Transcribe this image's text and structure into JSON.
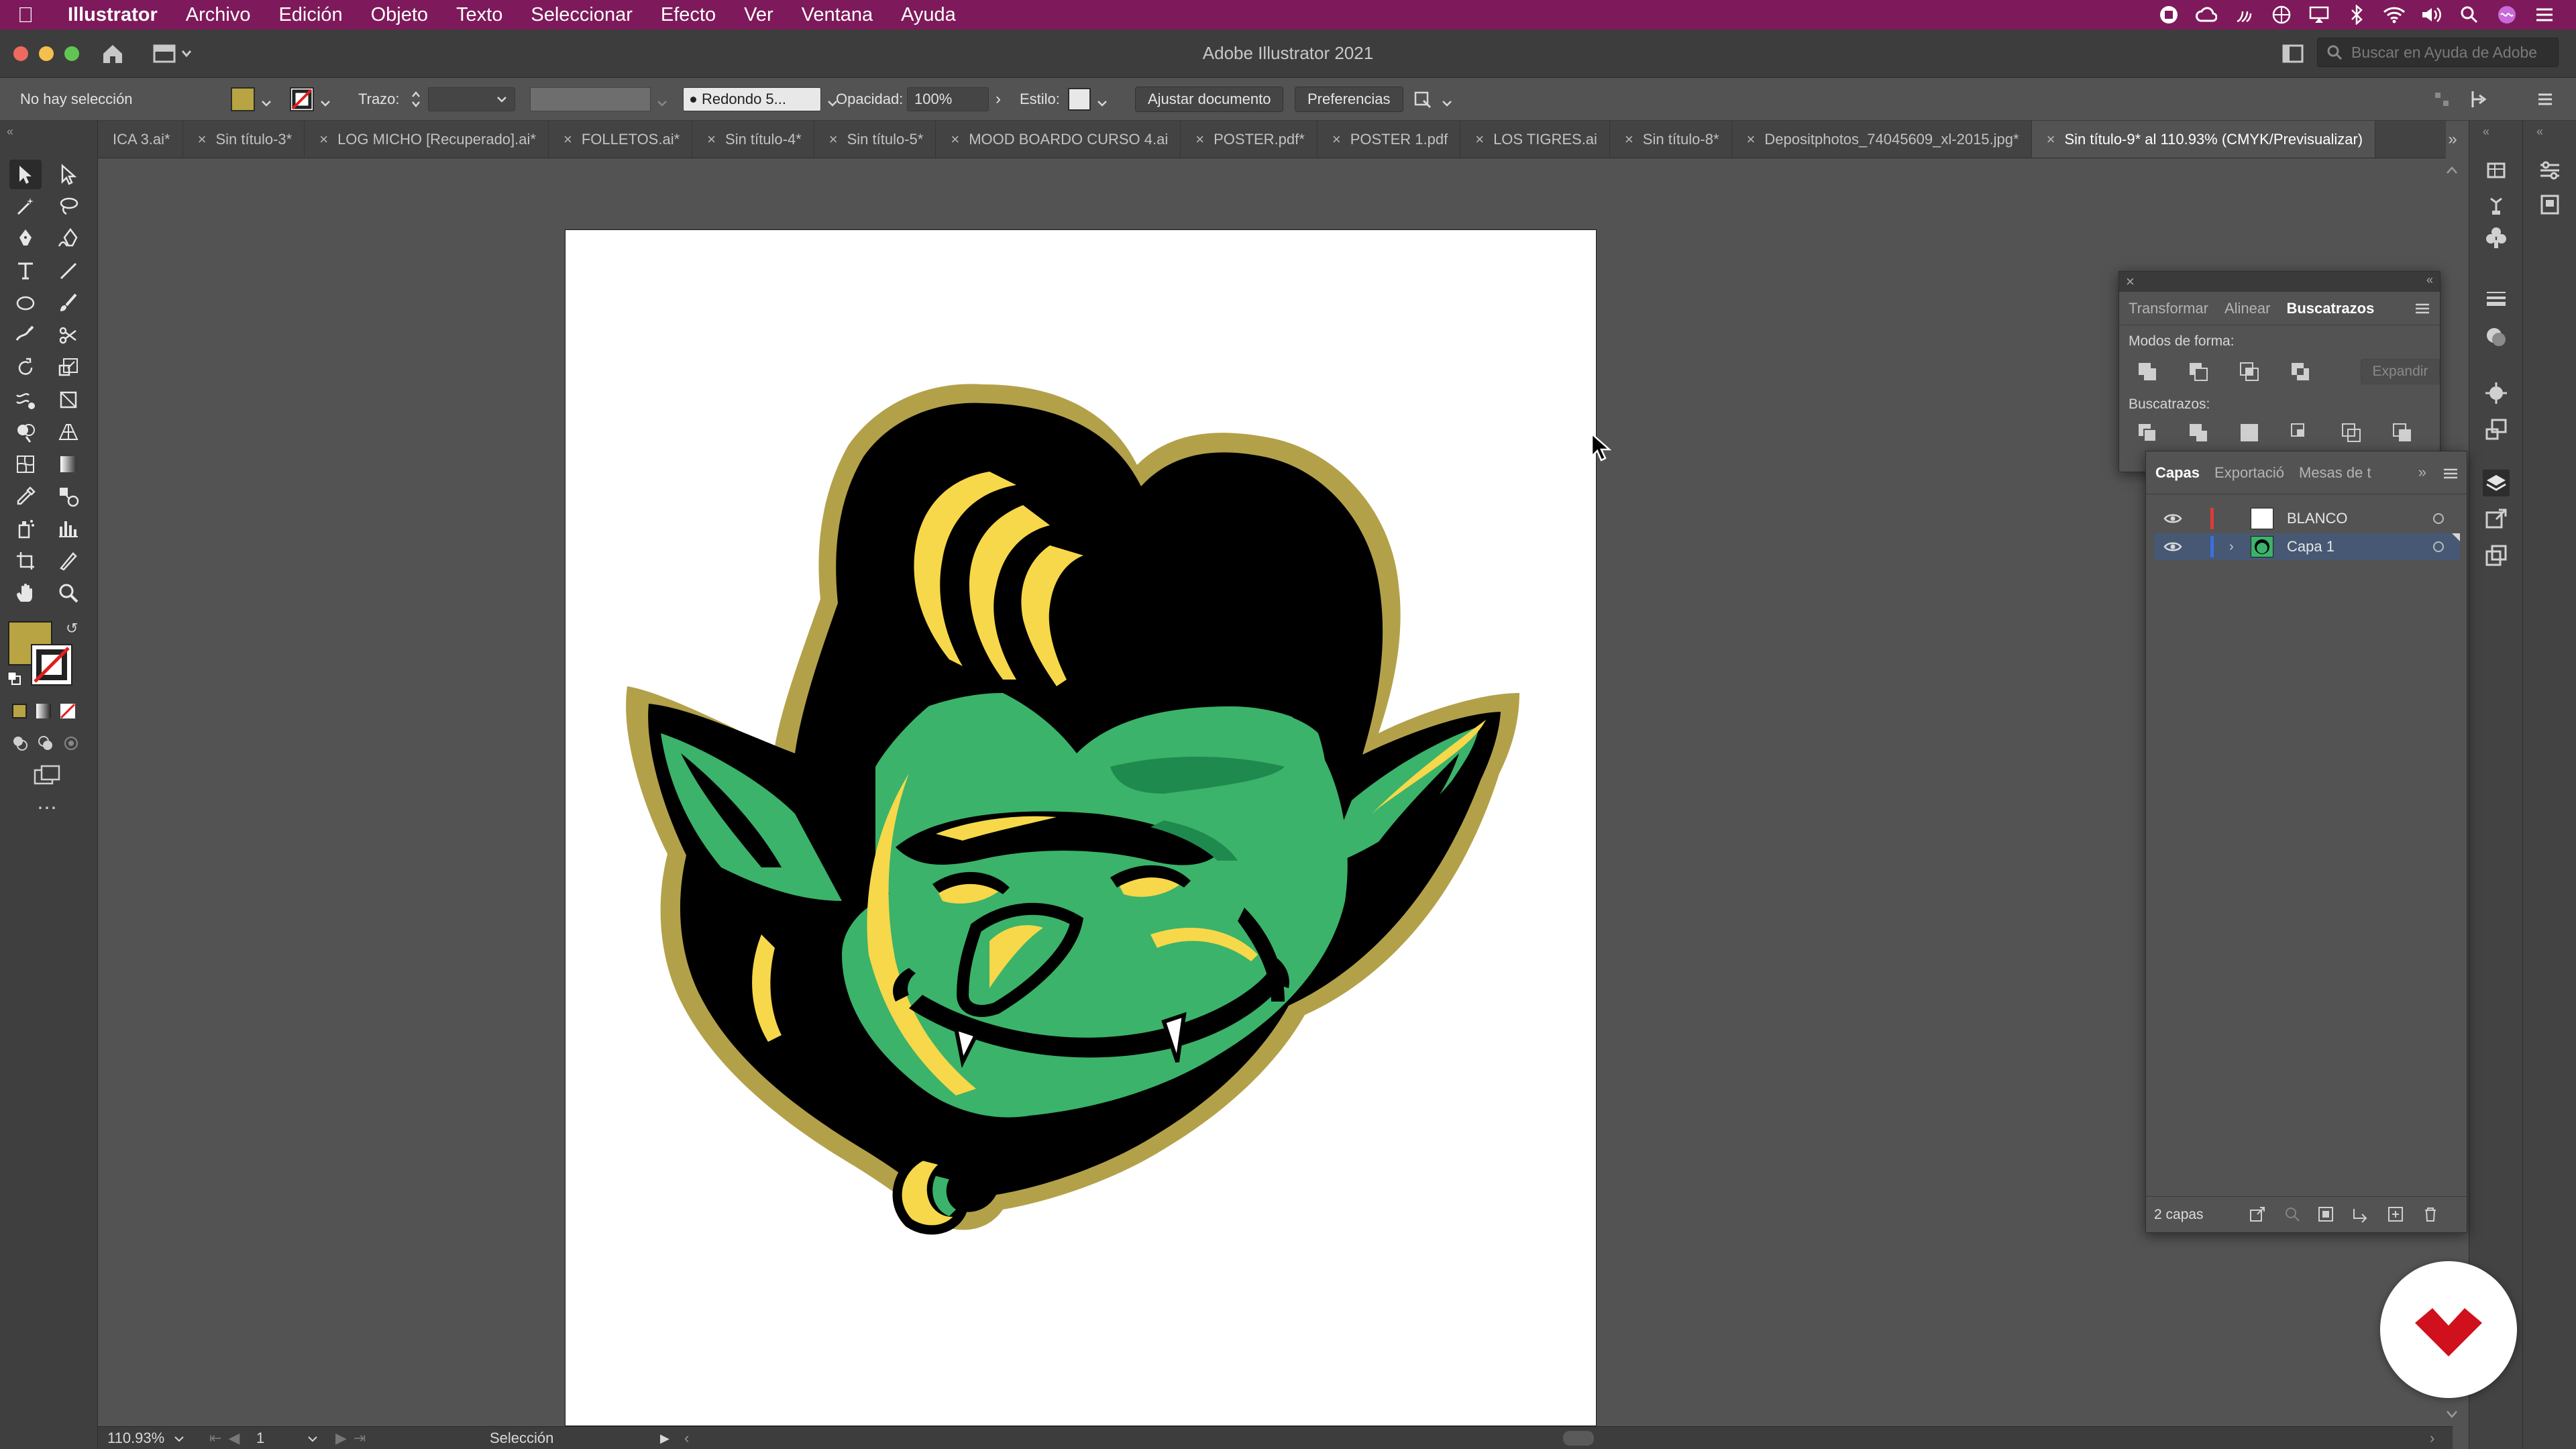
{
  "menubar": {
    "app_name": "Illustrator",
    "items": [
      "Archivo",
      "Edición",
      "Objeto",
      "Texto",
      "Seleccionar",
      "Efecto",
      "Ver",
      "Ventana",
      "Ayuda"
    ],
    "status_icons": [
      "record-icon",
      "creative-cloud-icon",
      "sync-icon",
      "globe-icon",
      "airplay-icon",
      "bluetooth-icon",
      "wifi-icon",
      "volume-icon",
      "search-icon",
      "siri-icon",
      "control-center-icon"
    ]
  },
  "titlebar": {
    "title": "Adobe Illustrator 2021",
    "help_placeholder": "Buscar en Ayuda de Adobe"
  },
  "controlbar": {
    "selection_label": "No hay selección",
    "fill_color": "#b8a442",
    "stroke_label": "Trazo:",
    "brush_label": "Redondo 5...",
    "opacity_label": "Opacidad:",
    "opacity_value": "100%",
    "style_label": "Estilo:",
    "fit_button": "Ajustar documento",
    "prefs_button": "Preferencias"
  },
  "tabs": [
    {
      "label": "ICA 3.ai*",
      "active": false,
      "closable": false
    },
    {
      "label": "Sin título-3*",
      "active": false,
      "closable": true
    },
    {
      "label": "LOG MICHO [Recuperado].ai*",
      "active": false,
      "closable": true
    },
    {
      "label": "FOLLETOS.ai*",
      "active": false,
      "closable": true
    },
    {
      "label": "Sin título-4*",
      "active": false,
      "closable": true
    },
    {
      "label": "Sin título-5*",
      "active": false,
      "closable": true
    },
    {
      "label": "MOOD BOARDO CURSO 4.ai",
      "active": false,
      "closable": true
    },
    {
      "label": "POSTER.pdf*",
      "active": false,
      "closable": true
    },
    {
      "label": "POSTER 1.pdf",
      "active": false,
      "closable": true
    },
    {
      "label": "LOS TIGRES.ai",
      "active": false,
      "closable": true
    },
    {
      "label": "Sin título-8*",
      "active": false,
      "closable": true
    },
    {
      "label": "Depositphotos_74045609_xl-2015.jpg*",
      "active": false,
      "closable": true
    },
    {
      "label": "Sin título-9* al 110.93% (CMYK/Previsualizar)",
      "active": true,
      "closable": true
    }
  ],
  "tools": [
    [
      "selection-tool",
      "direct-selection-tool"
    ],
    [
      "magic-wand-tool",
      "lasso-tool"
    ],
    [
      "pen-tool",
      "curvature-tool"
    ],
    [
      "type-tool",
      "line-segment-tool"
    ],
    [
      "ellipse-tool",
      "paintbrush-tool"
    ],
    [
      "shaper-tool",
      "scissors-tool"
    ],
    [
      "rotate-tool",
      "scale-tool"
    ],
    [
      "warp-tool",
      "free-transform-tool"
    ],
    [
      "shape-builder-tool",
      "perspective-grid-tool"
    ],
    [
      "mesh-tool",
      "gradient-tool"
    ],
    [
      "eyedropper-tool",
      "blend-tool"
    ],
    [
      "symbol-sprayer-tool",
      "column-graph-tool"
    ],
    [
      "artboard-tool",
      "slice-tool"
    ],
    [
      "hand-tool",
      "zoom-tool"
    ]
  ],
  "pathfinder": {
    "tabs": [
      "Transformar",
      "Alinear",
      "Buscatrazos"
    ],
    "active_tab": "Buscatrazos",
    "shape_modes_label": "Modos de forma:",
    "expand_button": "Expandir",
    "pathfinders_label": "Buscatrazos:"
  },
  "layers": {
    "tabs": [
      "Capas",
      "Exportació",
      "Mesas de t"
    ],
    "active_tab": "Capas",
    "items": [
      {
        "name": "BLANCO",
        "color": "#e03a3a",
        "selected": false,
        "expandable": false
      },
      {
        "name": "Capa 1",
        "color": "#3b6fe0",
        "selected": true,
        "expandable": true
      }
    ],
    "count_label": "2 capas"
  },
  "statusbar": {
    "zoom": "110.93%",
    "artboard_number": "1",
    "tool_name": "Selección"
  },
  "colors": {
    "menubar": "#7e1a5b",
    "troll_green": "#3bb36a",
    "troll_dark_green": "#1f8a4e",
    "troll_yellow": "#f6d84a",
    "troll_outline": "#b3a14a",
    "logo_red": "#d0101c"
  }
}
